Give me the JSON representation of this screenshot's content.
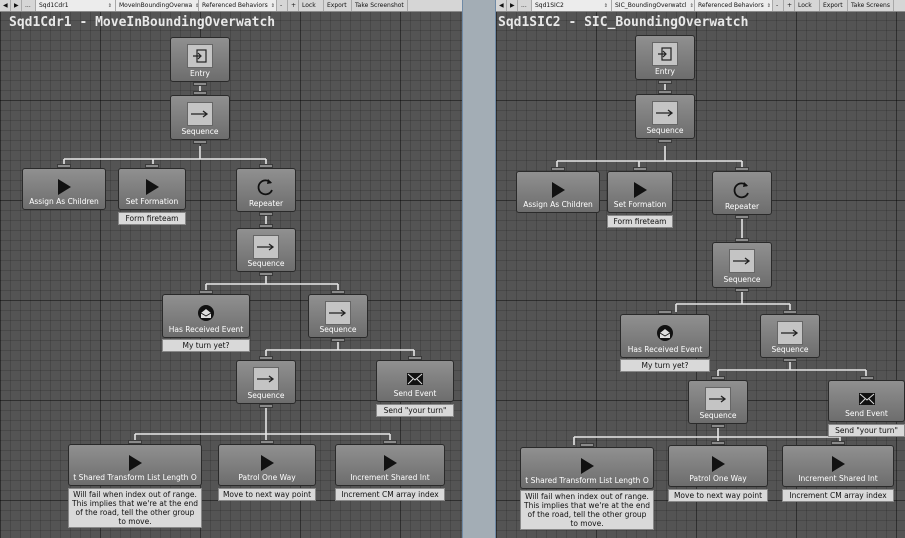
{
  "left": {
    "toolbar": {
      "prev": "◀",
      "next": "▶",
      "more": "...",
      "object": "Sqd1Cdr1",
      "behavior": "MoveInBoundingOverwa",
      "referenced": "Referenced Behaviors",
      "minus": "-",
      "plus": "+",
      "lock": "Lock",
      "export": "Export",
      "screenshot": "Take Screenshot"
    },
    "title": "Sqd1Cdr1 - MoveInBoundingOverwatch",
    "nodes": {
      "entry": "Entry",
      "sequence_root": "Sequence",
      "assign": "Assign As Children",
      "set_formation": "Set Formation",
      "set_formation_comment": "Form fireteam",
      "repeater": "Repeater",
      "sequence_inner": "Sequence",
      "has_received": "Has Received Event",
      "has_received_comment": "My turn yet?",
      "sequence_right": "Sequence",
      "sequence_bottom": "Sequence",
      "send_event": "Send Event",
      "send_event_comment": "Send \"your turn\"",
      "shared_transform": "t Shared Transform List   Length O",
      "shared_transform_comment": "Will fail when index out of range. This implies that we're at the end of the road, tell the other group to move.",
      "patrol": "Patrol One Way",
      "patrol_comment": "Move to next way point",
      "increment": "Increment Shared Int",
      "increment_comment": "Increment CM array index"
    }
  },
  "right": {
    "toolbar": {
      "prev": "◀",
      "next": "▶",
      "more": "...",
      "object": "Sqd1SIC2",
      "behavior": "SIC_BoundingOverwatcl",
      "referenced": "Referenced Behaviors",
      "minus": "-",
      "plus": "+",
      "lock": "Lock",
      "export": "Export",
      "screenshot": "Take Screens"
    },
    "title": "Sqd1SIC2 - SIC_BoundingOverwatch",
    "nodes": {
      "entry": "Entry",
      "sequence_root": "Sequence",
      "assign": "Assign As Children",
      "set_formation": "Set Formation",
      "set_formation_comment": "Form fireteam",
      "repeater": "Repeater",
      "sequence_inner": "Sequence",
      "has_received": "Has Received Event",
      "has_received_comment": "My turn yet?",
      "sequence_right": "Sequence",
      "sequence_bottom": "Sequence",
      "send_event": "Send Event",
      "send_event_comment": "Send \"your turn\"",
      "shared_transform": "t Shared Transform List   Length O",
      "shared_transform_comment": "Will fail when index out of range. This implies that we're at the end of the road, tell the other group to move.",
      "patrol": "Patrol One Way",
      "patrol_comment": "Move to next way point",
      "increment": "Increment Shared Int",
      "increment_comment": "Increment CM array index"
    }
  },
  "icons": {
    "entry": "entry-icon",
    "sequence": "arrow-right-icon",
    "action": "play-icon",
    "repeater": "repeat-icon",
    "received": "envelope-open-icon",
    "send": "envelope-icon"
  },
  "colors": {
    "canvas": "#545454",
    "node": "#7d7d7d",
    "wire": "#e6e6e6",
    "note": "#d9d9d9",
    "splitter": "#a3adb5"
  }
}
